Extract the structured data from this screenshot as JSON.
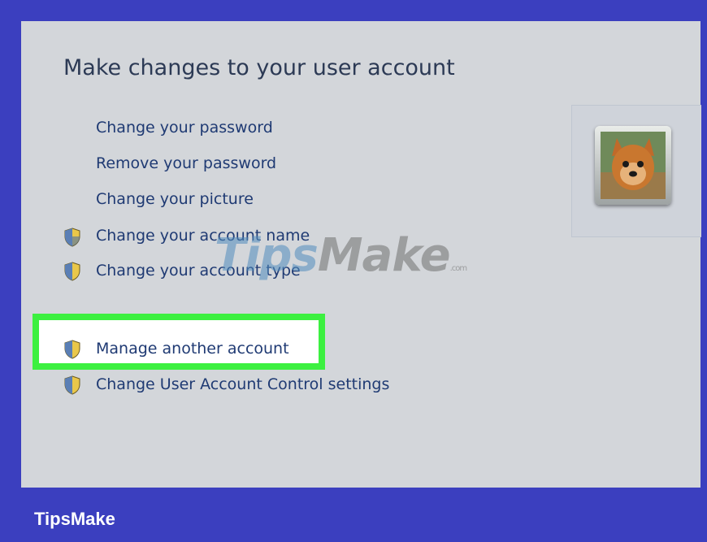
{
  "page": {
    "title": "Make changes to your user account"
  },
  "links": [
    {
      "label": "Change your password",
      "shield": false
    },
    {
      "label": "Remove your password",
      "shield": false
    },
    {
      "label": "Change your picture",
      "shield": false
    },
    {
      "label": "Change your account name",
      "shield": true
    },
    {
      "label": "Change your account type",
      "shield": true
    },
    {
      "label": "Manage another account",
      "shield": true,
      "highlighted": true
    },
    {
      "label": "Change User Account Control settings",
      "shield": true
    }
  ],
  "user_picture": {
    "icon": "dog-avatar"
  },
  "watermark": {
    "part1": "Tips",
    "part2": "Make",
    "tld": ".com"
  },
  "brand": {
    "label": "TipsMake"
  },
  "colors": {
    "frame": "#3b3fbf",
    "panel": "#d3d6da",
    "link": "#1f3a73",
    "highlight_border": "#3cf040"
  }
}
